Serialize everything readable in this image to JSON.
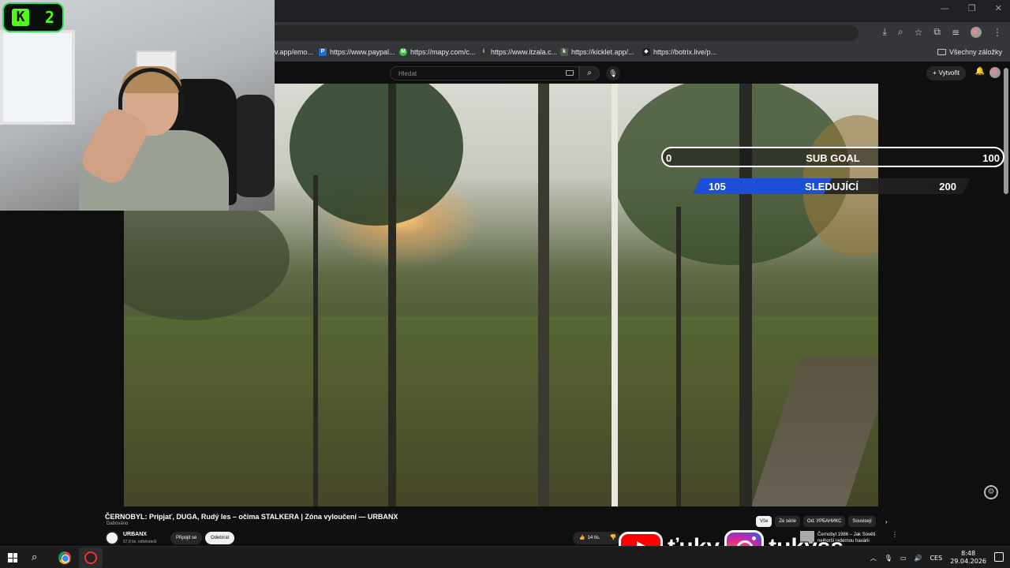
{
  "window": {
    "min": "—",
    "max": "❐",
    "close": "✕"
  },
  "toolbar_icons": [
    "⤓",
    "⌕",
    "☆",
    "⧉",
    "≡",
    "⋮"
  ],
  "bookmarks": [
    {
      "label": "v.app/emo...",
      "color": "#5f6368",
      "glyph": ""
    },
    {
      "label": "https://www.paypal...",
      "color": "#1e6bd6",
      "glyph": "P"
    },
    {
      "label": "https://mapy.com/c...",
      "color": "#2fbf3f",
      "glyph": "M"
    },
    {
      "label": "https://www.itzala.c...",
      "color": "#333333",
      "glyph": "i"
    },
    {
      "label": "https://kicklet.app/...",
      "color": "#4a5a4a",
      "glyph": "k"
    },
    {
      "label": "https://botrix.live/p...",
      "color": "#222222",
      "glyph": "◆"
    }
  ],
  "bookmarks_all": "Všechny záložky",
  "yt": {
    "search_placeholder": "Hledat",
    "create_label": "Vytvořit",
    "create_icon": "+",
    "bell_icon": "🔔",
    "search_icon": "⌕",
    "mic_icon": "🎙"
  },
  "kick": {
    "logo": "K",
    "count": "2"
  },
  "sub_goal": {
    "min": "0",
    "label": "SUB GOAL",
    "max": "100"
  },
  "follow_goal": {
    "current": "105",
    "label": "SLEDUJÍCÍ",
    "max": "200",
    "progress": 0.5
  },
  "video": {
    "title": "ČERNOBYL: Pripjať, DUGA, Rudý les – očima STALKERA | Zóna vyloučení — URBANX",
    "dubbed": "Dabováno",
    "channel": "URBANX",
    "subscribers": "67,8 tis. odběratelů",
    "join": "Připojit se",
    "unsubscribe": "Odebírat",
    "likes": "14 tis.",
    "like_icon": "👍",
    "dislike_icon": "👎",
    "settings_icon": "⚙"
  },
  "chips": [
    "Vše",
    "Ze série",
    "Od: УРБАНИКС",
    "Souvisejí"
  ],
  "chips_next": "›",
  "recommendation": {
    "line1": "Černobyl 1986 – Jak Sověti",
    "line2": "nejhorší jadernou havárii",
    "more": "⋮"
  },
  "social": {
    "youtube": "ťuky",
    "instagram": "tukyss_"
  },
  "taskbar": {
    "search_icon": "⌕",
    "tray_icons": [
      "︿",
      "🎙",
      "▭",
      "🔊"
    ],
    "lang": "CES",
    "time": "8:48",
    "date": "29.04.2026"
  }
}
